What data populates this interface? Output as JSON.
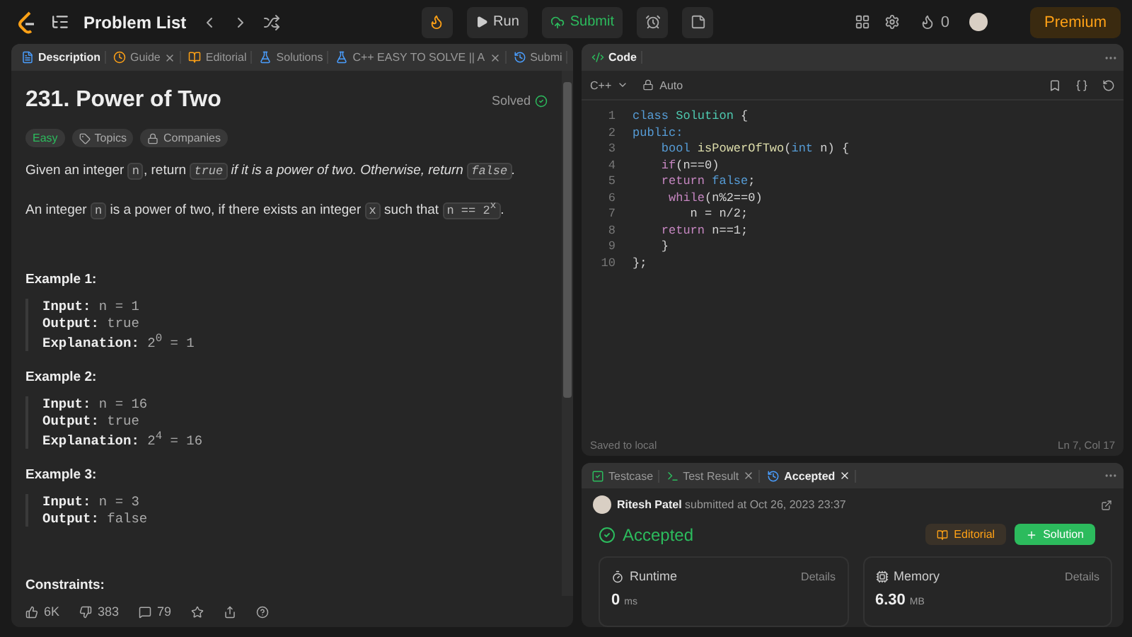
{
  "topbar": {
    "title": "Problem List",
    "run": "Run",
    "submit": "Submit",
    "streak": "0",
    "premium": "Premium"
  },
  "left_tabs": [
    {
      "label": "Description",
      "closable": false,
      "selected": true
    },
    {
      "label": "Guide",
      "closable": true,
      "selected": false
    },
    {
      "label": "Editorial",
      "closable": false,
      "selected": false
    },
    {
      "label": "Solutions",
      "closable": false,
      "selected": false
    },
    {
      "label": "C++ EASY TO SOLVE || A",
      "closable": true,
      "selected": false
    },
    {
      "label": "Submi",
      "closable": false,
      "selected": false
    }
  ],
  "problem": {
    "title": "231. Power of Two",
    "status": "Solved",
    "difficulty": "Easy",
    "topics": "Topics",
    "companies": "Companies",
    "paragraphs": [
      [
        {
          "kind": "text",
          "text": "Given an integer "
        },
        {
          "kind": "code",
          "text": "n"
        },
        {
          "kind": "text",
          "text": ", return "
        },
        {
          "kind": "code_italic",
          "text": "true"
        },
        {
          "kind": "italic",
          "text": " if it is a power of two. Otherwise, return "
        },
        {
          "kind": "code_italic",
          "text": "false"
        },
        {
          "kind": "italic",
          "text": "."
        }
      ],
      [
        {
          "kind": "text",
          "text": "An integer "
        },
        {
          "kind": "code",
          "text": "n"
        },
        {
          "kind": "text",
          "text": " is a power of two, if there exists an integer "
        },
        {
          "kind": "code",
          "text": "x"
        },
        {
          "kind": "text",
          "text": " such that "
        },
        {
          "kind": "code",
          "text": "n == 2$^{x}$"
        },
        {
          "kind": "text",
          "text": "."
        }
      ]
    ],
    "examples": [
      {
        "title": "Example 1:",
        "lines": [
          {
            "label": "Input:",
            "value": "n = 1"
          },
          {
            "label": "Output:",
            "value": "true"
          },
          {
            "label": "Explanation:",
            "value": "2$^{0}$ = 1"
          }
        ]
      },
      {
        "title": "Example 2:",
        "lines": [
          {
            "label": "Input:",
            "value": "n = 16"
          },
          {
            "label": "Output:",
            "value": "true"
          },
          {
            "label": "Explanation:",
            "value": "2$^{4}$ = 16"
          }
        ]
      },
      {
        "title": "Example 3:",
        "lines": [
          {
            "label": "Input:",
            "value": "n = 3"
          },
          {
            "label": "Output:",
            "value": "false"
          }
        ]
      }
    ],
    "constraints": "Constraints:",
    "likes": "6K",
    "dislikes": "383",
    "comments": "79"
  },
  "code_panel": {
    "title": "Code",
    "language": "C++",
    "mode": "Auto",
    "status": "Saved to local",
    "cursor": "Ln 7, Col 17",
    "lines": [
      {
        "number": "1",
        "tokens": [
          {
            "kind": "kw",
            "text": "class"
          },
          {
            "kind": "type",
            "text": " Solution"
          },
          {
            "kind": "plain",
            "text": " {"
          }
        ]
      },
      {
        "number": "2",
        "tokens": [
          {
            "kind": "kw",
            "text": "public:"
          }
        ]
      },
      {
        "number": "3",
        "tokens": [
          {
            "kind": "kw",
            "text": "    bool"
          },
          {
            "kind": "fn",
            "text": " isPowerOfTwo"
          },
          {
            "kind": "plain",
            "text": "("
          },
          {
            "kind": "kw",
            "text": "int"
          },
          {
            "kind": "plain",
            "text": " n) {"
          }
        ]
      },
      {
        "number": "4",
        "tokens": [
          {
            "kind": "ctrl",
            "text": "    if"
          },
          {
            "kind": "plain",
            "text": "(n==0)"
          }
        ]
      },
      {
        "number": "5",
        "tokens": [
          {
            "kind": "ctrl",
            "text": "    return"
          },
          {
            "kind": "kw",
            "text": " false"
          },
          {
            "kind": "plain",
            "text": ";"
          }
        ]
      },
      {
        "number": "6",
        "tokens": [
          {
            "kind": "ctrl",
            "text": "     while"
          },
          {
            "kind": "plain",
            "text": "(n%2==0)"
          }
        ]
      },
      {
        "number": "7",
        "tokens": [
          {
            "kind": "plain",
            "text": "        n = n/2;"
          }
        ]
      },
      {
        "number": "8",
        "tokens": [
          {
            "kind": "ctrl",
            "text": "    return"
          },
          {
            "kind": "plain",
            "text": " n==1;"
          }
        ]
      },
      {
        "number": "9",
        "tokens": [
          {
            "kind": "plain",
            "text": "    }"
          }
        ]
      },
      {
        "number": "10",
        "tokens": [
          {
            "kind": "plain",
            "text": "};"
          }
        ]
      }
    ]
  },
  "result_tabs": [
    {
      "label": "Testcase",
      "closable": false,
      "selected": false
    },
    {
      "label": "Test Result",
      "closable": true,
      "selected": false
    },
    {
      "label": "Accepted",
      "closable": true,
      "selected": true
    }
  ],
  "submission": {
    "user": "Ritesh Patel",
    "meta": "submitted at Oct 26, 2023 23:37",
    "verdict": "Accepted",
    "editorial": "Editorial",
    "solution": "Solution",
    "stats": [
      {
        "kind": "runtime",
        "label": "Runtime",
        "details": "Details",
        "value": "0",
        "unit": "ms"
      },
      {
        "kind": "memory",
        "label": "Memory",
        "details": "Details",
        "value": "6.30",
        "unit": "MB"
      }
    ]
  }
}
